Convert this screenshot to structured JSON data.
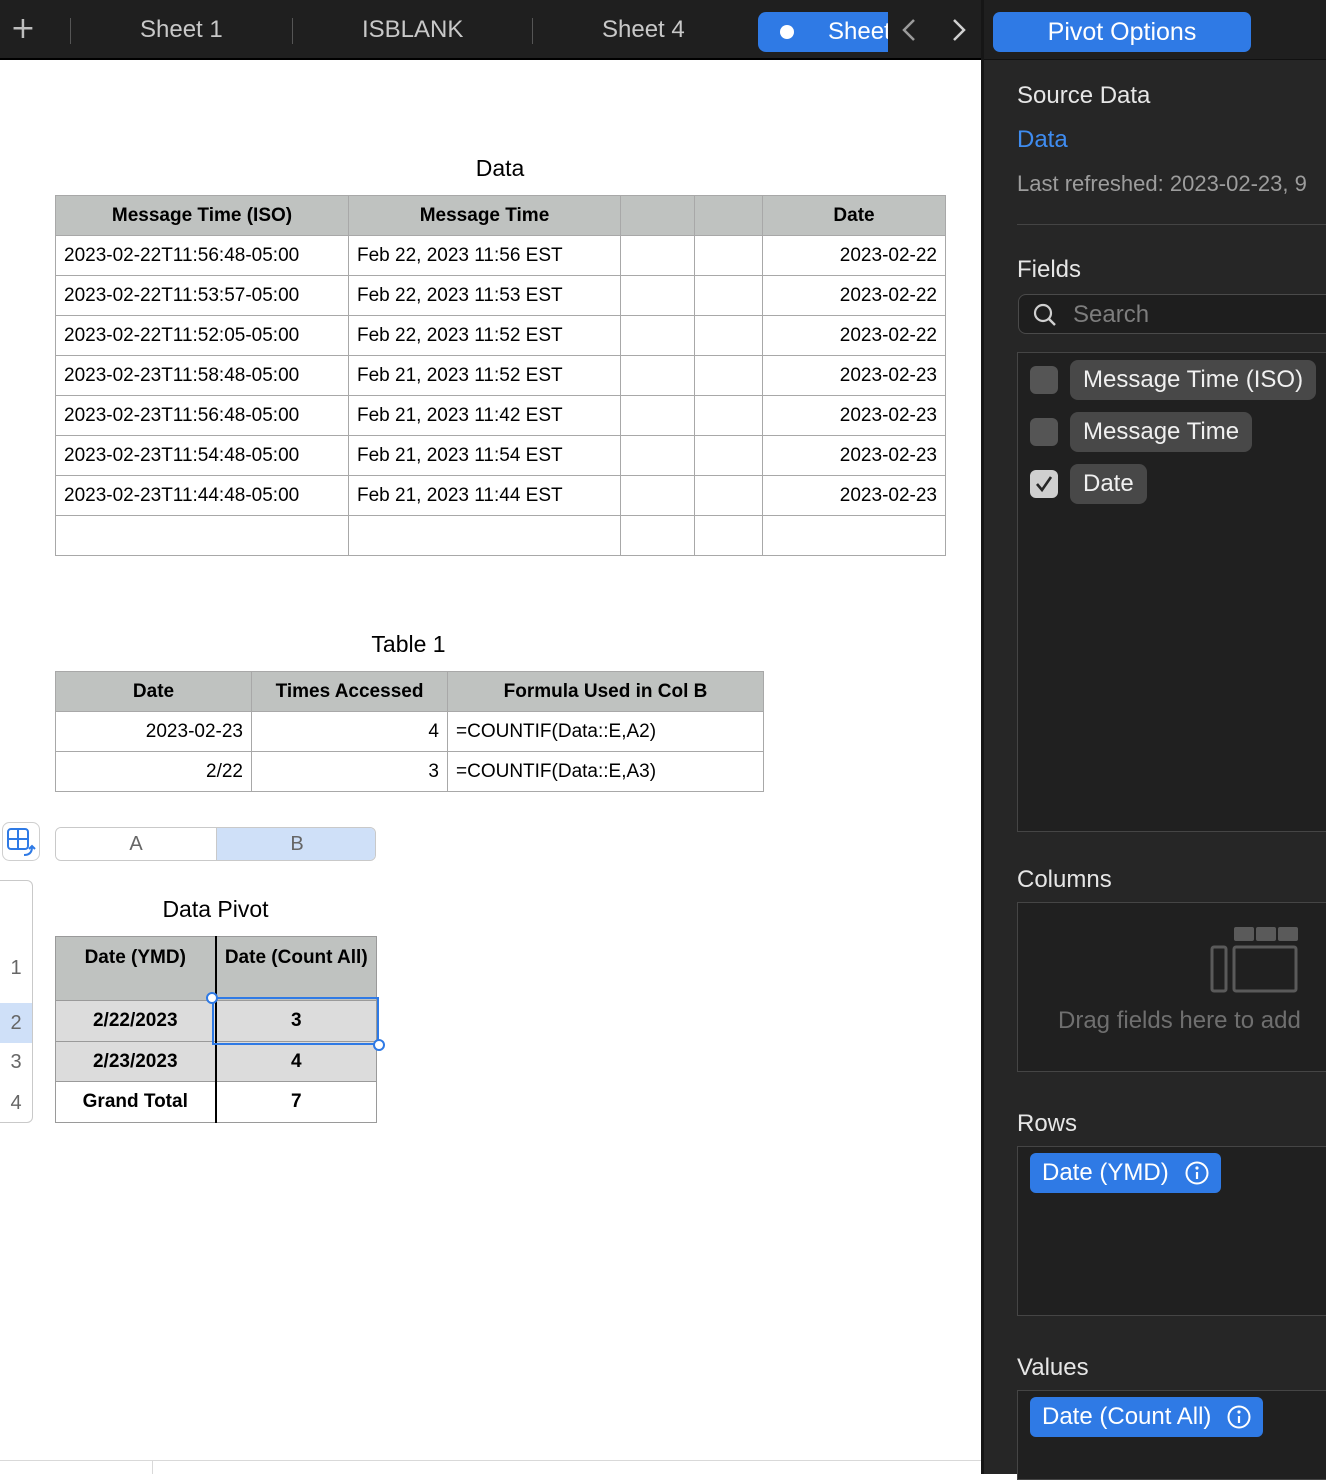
{
  "tabs": {
    "add_label": "+",
    "items": [
      "Sheet 1",
      "ISBLANK",
      "Sheet 4"
    ],
    "active": "Sheet"
  },
  "panel": {
    "title": "Pivot Options",
    "source_heading": "Source Data",
    "source_link": "Data",
    "last_refreshed": "Last refreshed: 2023-02-23, 9",
    "fields_heading": "Fields",
    "search_placeholder": "Search",
    "fields": [
      {
        "label": "Message Time (ISO)",
        "checked": false
      },
      {
        "label": "Message Time",
        "checked": false
      },
      {
        "label": "Date",
        "checked": true
      }
    ],
    "columns_heading": "Columns",
    "columns_hint": "Drag fields here to add",
    "rows_heading": "Rows",
    "rows_chip": "Date (YMD)",
    "values_heading": "Values",
    "values_chip": "Date (Count All)"
  },
  "data_table": {
    "title": "Data",
    "headers": [
      "Message Time (ISO)",
      "Message Time",
      "",
      "",
      "Date"
    ],
    "rows": [
      [
        "2023-02-22T11:56:48-05:00",
        "Feb 22, 2023 11:56 EST",
        "",
        "",
        "2023-02-22"
      ],
      [
        "2023-02-22T11:53:57-05:00",
        "Feb 22, 2023 11:53 EST",
        "",
        "",
        "2023-02-22"
      ],
      [
        "2023-02-22T11:52:05-05:00",
        "Feb 22, 2023 11:52 EST",
        "",
        "",
        "2023-02-22"
      ],
      [
        "2023-02-23T11:58:48-05:00",
        "Feb 21, 2023 11:52 EST",
        "",
        "",
        "2023-02-23"
      ],
      [
        "2023-02-23T11:56:48-05:00",
        "Feb 21, 2023 11:42 EST",
        "",
        "",
        "2023-02-23"
      ],
      [
        "2023-02-23T11:54:48-05:00",
        "Feb 21, 2023 11:54 EST",
        "",
        "",
        "2023-02-23"
      ],
      [
        "2023-02-23T11:44:48-05:00",
        "Feb 21, 2023 11:44 EST",
        "",
        "",
        "2023-02-23"
      ],
      [
        "",
        "",
        "",
        "",
        ""
      ]
    ]
  },
  "table1": {
    "title": "Table 1",
    "headers": [
      "Date",
      "Times Accessed",
      "Formula Used in Col B"
    ],
    "rows": [
      [
        "2023-02-23",
        "4",
        "=COUNTIF(Data::E,A2)"
      ],
      [
        "2/22",
        "3",
        "=COUNTIF(Data::E,A3)"
      ]
    ]
  },
  "pivot": {
    "title": "Data Pivot",
    "col_headers": [
      "A",
      "B"
    ],
    "row_numbers": [
      "1",
      "2",
      "3",
      "4"
    ],
    "headers": [
      "Date (YMD)",
      "Date (Count All)"
    ],
    "rows": [
      [
        "2/22/2023",
        "3"
      ],
      [
        "2/23/2023",
        "4"
      ],
      [
        "Grand Total",
        "7"
      ]
    ]
  }
}
